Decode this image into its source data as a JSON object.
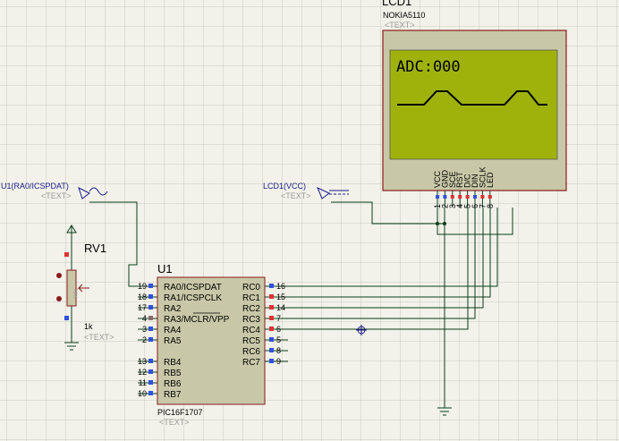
{
  "lcd": {
    "ref": "LCD1",
    "part": "NOKIA5110",
    "text_tag": "<TEXT>",
    "display_text": "ADC:000",
    "pins": [
      {
        "name": "VCC",
        "num": "1"
      },
      {
        "name": "GND",
        "num": "2"
      },
      {
        "name": "SCE",
        "num": "3"
      },
      {
        "name": "RST",
        "num": "4"
      },
      {
        "name": "D/C",
        "num": "5"
      },
      {
        "name": "DIN",
        "num": "6"
      },
      {
        "name": "SCLK",
        "num": "7"
      },
      {
        "name": "LED",
        "num": "8"
      }
    ]
  },
  "signals": {
    "analog_label": "U1(RA0/ICSPDAT)",
    "analog_tag": "<TEXT>",
    "vcc_label": "LCD1(VCC)",
    "vcc_tag": "<TEXT>"
  },
  "pot": {
    "ref": "RV1",
    "value": "1k",
    "text_tag": "<TEXT>",
    "percent": "71%"
  },
  "mcu": {
    "ref": "U1",
    "part": "PIC16F1707",
    "text_tag": "<TEXT>",
    "left_pins": [
      {
        "num": "19",
        "name": "RA0/ICSPDAT"
      },
      {
        "num": "18",
        "name": "RA1/ICSPCLK"
      },
      {
        "num": "17",
        "name": "RA2"
      },
      {
        "num": "4",
        "name": "RA3/MCLR/VPP"
      },
      {
        "num": "3",
        "name": "RA4"
      },
      {
        "num": "2",
        "name": "RA5"
      },
      {
        "num": "13",
        "name": "RB4"
      },
      {
        "num": "12",
        "name": "RB5"
      },
      {
        "num": "11",
        "name": "RB6"
      },
      {
        "num": "10",
        "name": "RB7"
      }
    ],
    "right_pins": [
      {
        "num": "16",
        "name": "RC0"
      },
      {
        "num": "15",
        "name": "RC1"
      },
      {
        "num": "14",
        "name": "RC2"
      },
      {
        "num": "7",
        "name": "RC3"
      },
      {
        "num": "6",
        "name": "RC4"
      },
      {
        "num": "5",
        "name": "RC5"
      },
      {
        "num": "8",
        "name": "RC6"
      },
      {
        "num": "9",
        "name": "RC7"
      }
    ]
  },
  "colors": {
    "grid": "#c9c9c0",
    "background": "#f2f2ea",
    "component_body": "#c8c8a8",
    "lcd_screen": "#9fb20c",
    "wire": "#0b3d1a",
    "pin_red": "#e03030",
    "pin_blue": "#3050e0"
  }
}
